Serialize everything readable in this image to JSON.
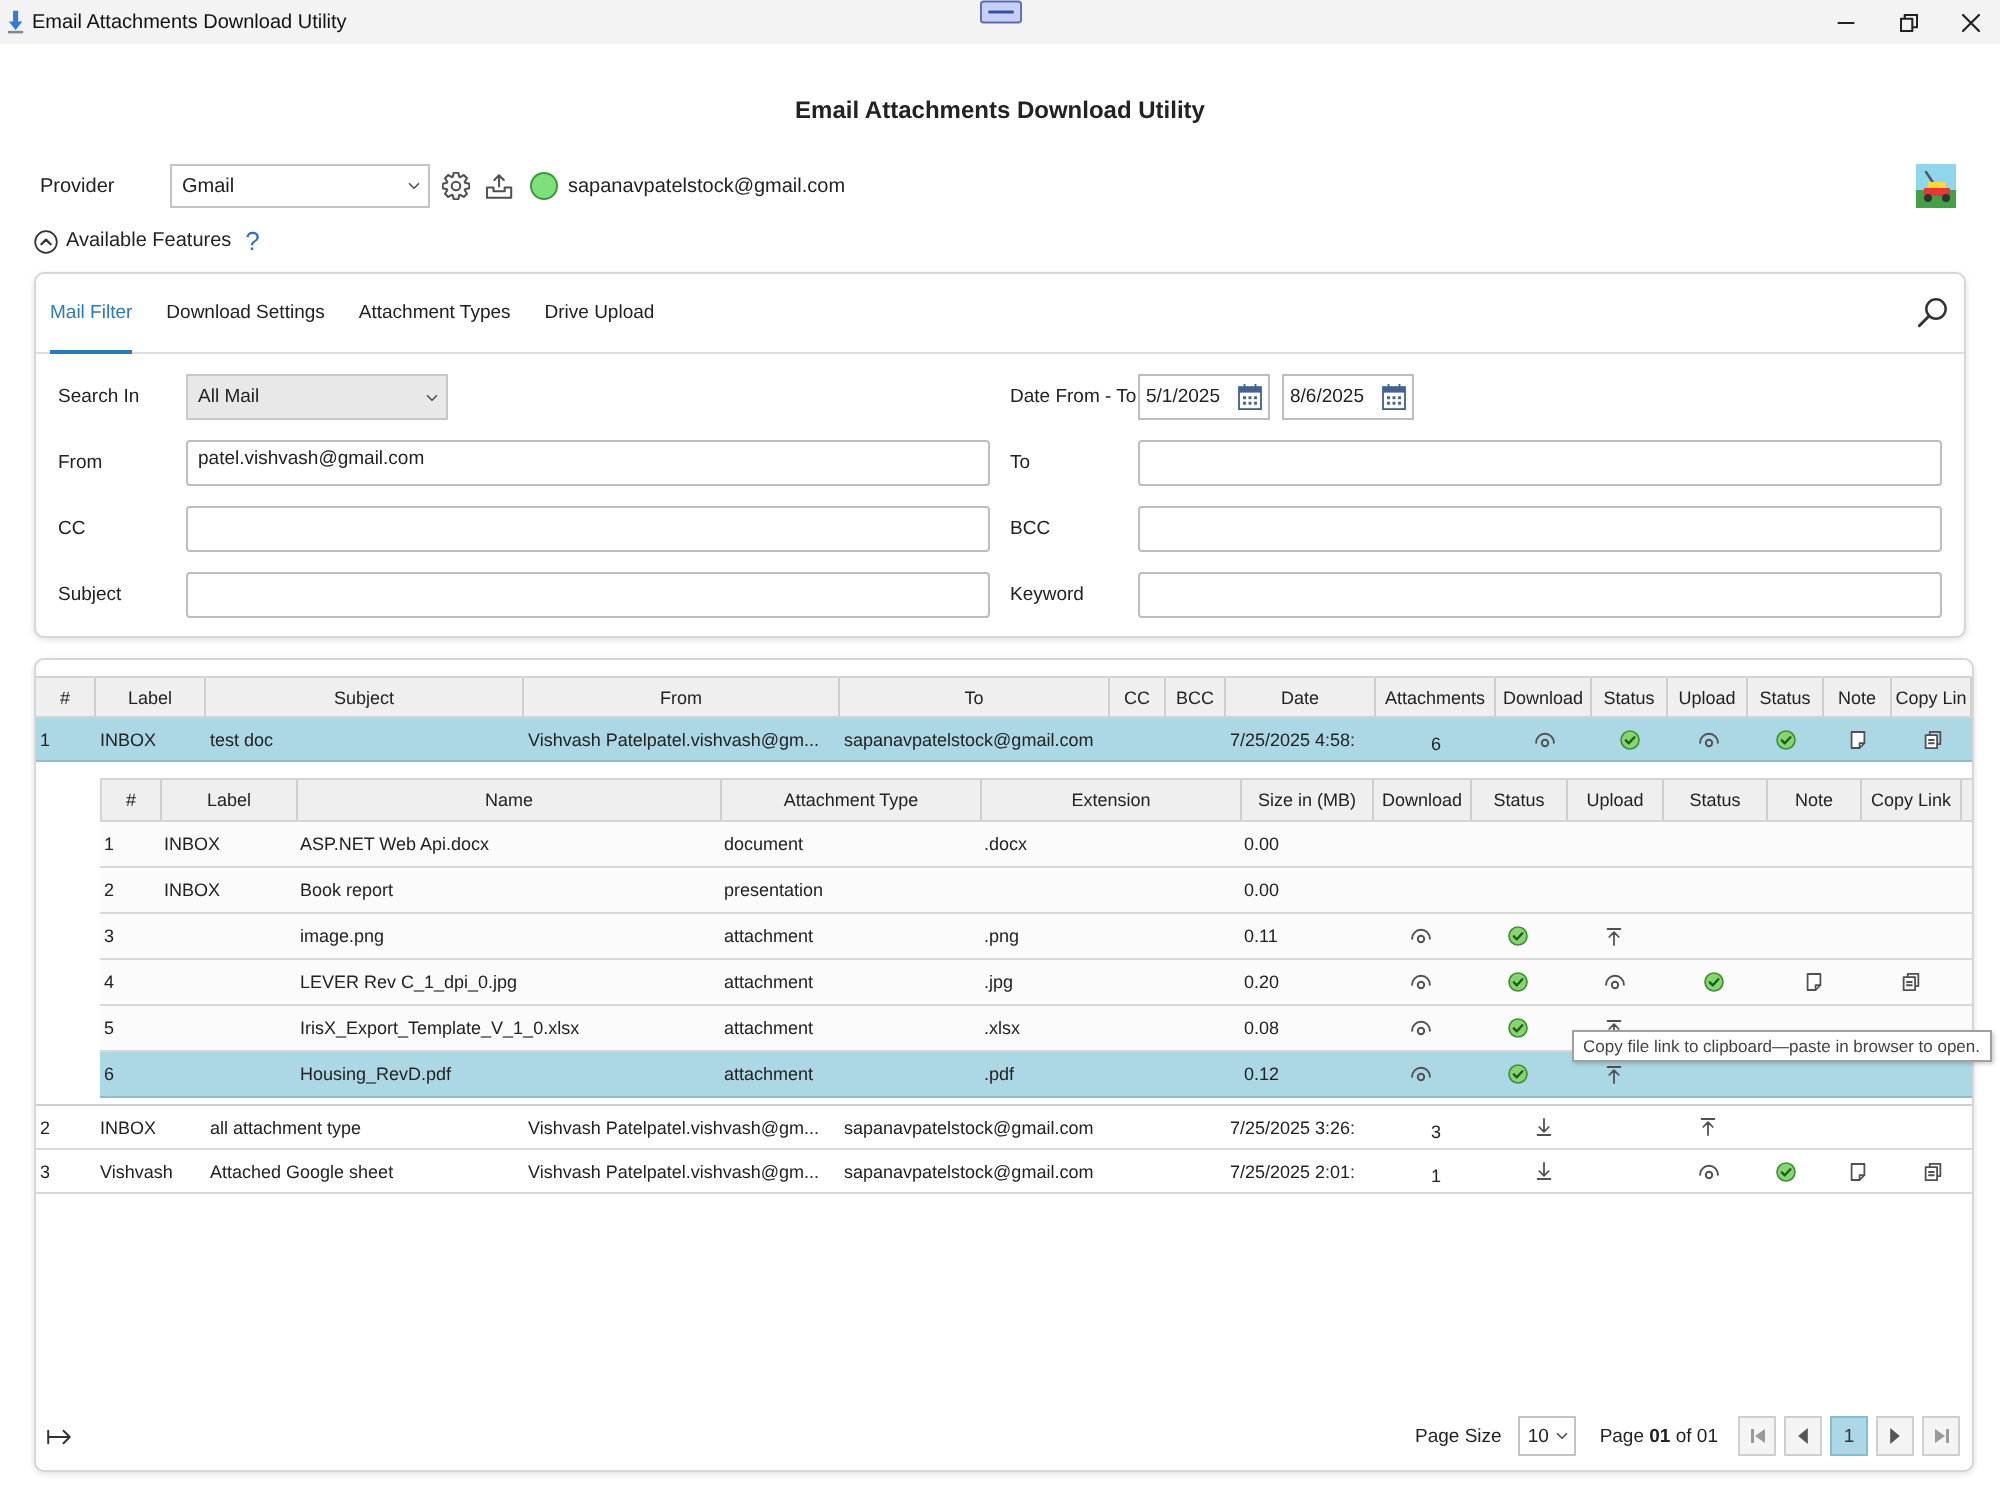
{
  "window": {
    "title": "Email Attachments Download Utility"
  },
  "heading": "Email Attachments Download Utility",
  "provider": {
    "label": "Provider",
    "value": "Gmail",
    "connected": true,
    "account": "sapanavpatelstock@gmail.com"
  },
  "features": {
    "label": "Available Features",
    "expanded": true,
    "help": "?"
  },
  "filter": {
    "tabs": [
      {
        "label": "Mail Filter",
        "selected": true
      },
      {
        "label": "Download Settings",
        "selected": false
      },
      {
        "label": "Attachment Types",
        "selected": false
      },
      {
        "label": "Drive Upload",
        "selected": false
      }
    ],
    "search_in": {
      "label": "Search In",
      "value": "All Mail"
    },
    "date_range": {
      "label": "Date From - To",
      "from": "5/1/2025",
      "to": "8/6/2025"
    },
    "fields": [
      {
        "label": "From",
        "value": "patel.vishvash@gmail.com"
      },
      {
        "label": "To"
      },
      {
        "label": "CC"
      },
      {
        "label": "BCC"
      },
      {
        "label": "Subject"
      },
      {
        "label": "Keyword"
      }
    ]
  },
  "mail_grid": {
    "columns": [
      "#",
      "Label",
      "Subject",
      "From",
      "To",
      "CC",
      "BCC",
      "Date",
      "Attachments",
      "Download",
      "Status",
      "Upload",
      "Status",
      "Note",
      "Copy Lin"
    ],
    "rows": [
      {
        "number": "1",
        "label": "INBOX",
        "subject": "test doc",
        "from": "Vishvash Patelpatel.vishvash@gm...",
        "to": "sapanavpatelstock@gmail.com",
        "date": "7/25/2025 4:58:",
        "attachments": "6",
        "download": {
          "done": true
        },
        "upload": {
          "done": true
        },
        "selected": true,
        "attachment_grid": {
          "columns": [
            "#",
            "Label",
            "Name",
            "Attachment Type",
            "Extension",
            "Size in (MB)",
            "Download",
            "Status",
            "Upload",
            "Status",
            "Note",
            "Copy Link"
          ],
          "rows": [
            {
              "number": "1",
              "label": "INBOX",
              "name": "ASP.NET Web Api.docx",
              "type": "document",
              "extension": ".docx",
              "size": "0.00",
              "selected": false
            },
            {
              "number": "2",
              "label": "INBOX",
              "name": "Book report",
              "type": "presentation",
              "size": "0.00",
              "selected": false
            },
            {
              "number": "3",
              "name": "image.png",
              "type": "attachment",
              "extension": ".png",
              "size": "0.11",
              "download": {
                "done": true
              },
              "upload": {
                "done": false
              },
              "selected": false
            },
            {
              "number": "4",
              "name": "LEVER Rev C_1_dpi_0.jpg",
              "type": "attachment",
              "extension": ".jpg",
              "size": "0.20",
              "download": {
                "done": true
              },
              "upload": {
                "done": true
              },
              "selected": false
            },
            {
              "number": "5",
              "name": "IrisX_Export_Template_V_1_0.xlsx",
              "type": "attachment",
              "extension": ".xlsx",
              "size": "0.08",
              "download": {
                "done": true
              },
              "upload": {
                "done": false
              },
              "selected": false
            },
            {
              "number": "6",
              "name": "Housing_RevD.pdf",
              "type": "attachment",
              "extension": ".pdf",
              "size": "0.12",
              "download": {
                "done": true
              },
              "upload": {
                "done": false
              },
              "selected": true
            }
          ]
        }
      },
      {
        "number": "2",
        "label": "INBOX",
        "subject": "all attachment type",
        "from": "Vishvash Patelpatel.vishvash@gm...",
        "to": "sapanavpatelstock@gmail.com",
        "date": "7/25/2025 3:26:",
        "attachments": "3",
        "download": {
          "done": false
        },
        "upload": {
          "done": false
        },
        "selected": false
      },
      {
        "number": "3",
        "label": "Vishvash",
        "subject": "Attached Google sheet",
        "from": "Vishvash Patelpatel.vishvash@gm...",
        "to": "sapanavpatelstock@gmail.com",
        "date": "7/25/2025 2:01:",
        "attachments": "1",
        "download": {
          "done": false
        },
        "upload": {
          "done": true
        },
        "selected": false
      }
    ]
  },
  "tooltip": {
    "text": "Copy file link to clipboard—paste in browser to open."
  },
  "pagination": {
    "page_size_label": "Page Size",
    "page_size": "10",
    "summary": "Page **01** of 01",
    "pages": [
      {
        "label": "1",
        "selected": true
      }
    ]
  }
}
